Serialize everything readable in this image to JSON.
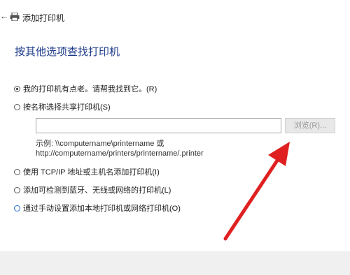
{
  "window": {
    "title": "添加打印机",
    "back_icon": "back-arrow-icon",
    "printer_icon": "printer-icon"
  },
  "page": {
    "heading": "按其他选项查找打印机"
  },
  "options": [
    {
      "label": "我的打印机有点老。请帮我找到它。(R)",
      "selected": true
    },
    {
      "label": "按名称选择共享打印机(S)",
      "selected": false
    },
    {
      "label": "使用 TCP/IP 地址或主机名添加打印机(I)",
      "selected": false
    },
    {
      "label": "添加可检测到蓝牙、无线或网络的打印机(L)",
      "selected": false
    },
    {
      "label": "通过手动设置添加本地打印机或网络打印机(O)",
      "selected": false,
      "focused": true
    }
  ],
  "share": {
    "input_value": "",
    "browse_label": "浏览(R)...",
    "example_line1": "示例: \\\\computername\\printername 或",
    "example_line2": "http://computername/printers/printername/.printer"
  },
  "annotation": {
    "arrow_color": "#e02020"
  }
}
